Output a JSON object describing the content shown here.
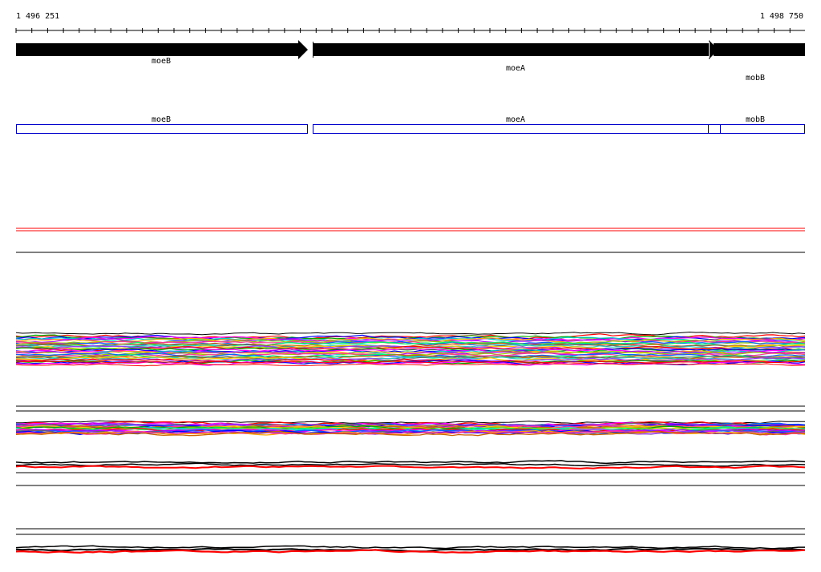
{
  "ruler": {
    "start_label": "1 496 251",
    "end_label": "1 498 750"
  },
  "genes": [
    {
      "name": "moeB"
    },
    {
      "name": "moeA"
    },
    {
      "name": "mobB"
    }
  ],
  "annotations": [
    {
      "name": "moeB"
    },
    {
      "name": "moeA"
    },
    {
      "name": "mobB"
    }
  ],
  "colors": {
    "gene_arrow": "#000000",
    "annotation_outline": "#0000cc",
    "track_black": "#000000",
    "track_red": "#ff0000",
    "palette": [
      "#ff0000",
      "#00aa00",
      "#0000ff",
      "#ff00ff",
      "#00cccc",
      "#ffaa00",
      "#aa00ff",
      "#99cc00",
      "#ff3399",
      "#0066ff",
      "#00ff66",
      "#cc6600",
      "#666666",
      "#33cccc",
      "#ffcc00",
      "#9933ff"
    ]
  }
}
